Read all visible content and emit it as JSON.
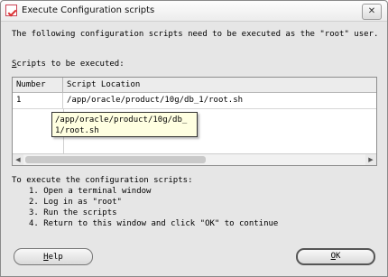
{
  "window": {
    "title": "Execute Configuration scripts",
    "close_glyph": "✕"
  },
  "intro_text": "The following configuration scripts need to be executed as the \"root\" user.",
  "scripts_label_first_char": "S",
  "scripts_label_rest": "cripts to be executed:",
  "table": {
    "columns": [
      "Number",
      "Script Location"
    ],
    "rows": [
      {
        "number": "1",
        "location": "/app/oracle/product/10g/db_1/root.sh"
      }
    ],
    "tooltip": "/app/oracle/product/10g/db_1/root.sh"
  },
  "scrollbar": {
    "left_arrow": "◀",
    "right_arrow": "▶"
  },
  "instructions": {
    "heading": "To execute the configuration scripts:",
    "steps": [
      "1. Open a terminal window",
      "2. Log in as \"root\"",
      "3. Run the scripts",
      "4. Return to this window and click \"OK\" to continue"
    ]
  },
  "buttons": {
    "help_mnemonic": "H",
    "help_rest": "elp",
    "ok_mnemonic": "O",
    "ok_rest": "K"
  }
}
